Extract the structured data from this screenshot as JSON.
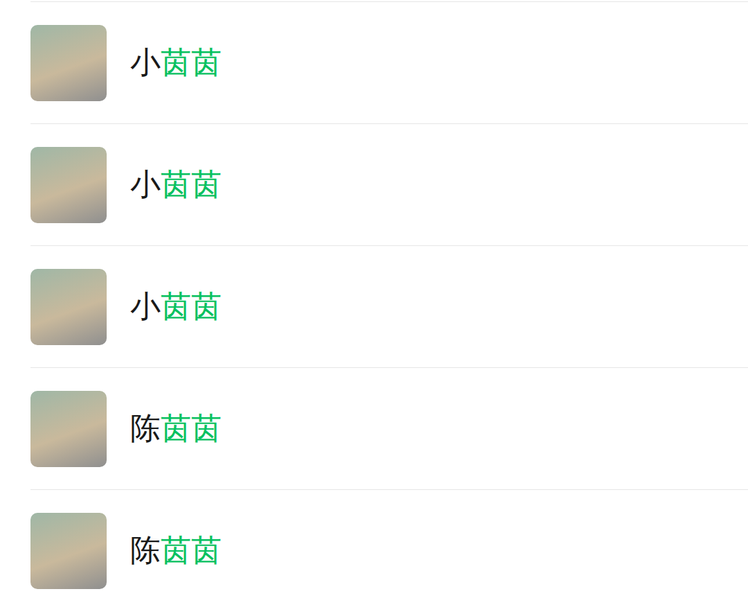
{
  "results": [
    {
      "name": [
        {
          "text": "小",
          "highlighted": false
        },
        {
          "text": "茵茵",
          "highlighted": true
        }
      ]
    },
    {
      "name": [
        {
          "text": "小",
          "highlighted": false
        },
        {
          "text": "茵茵",
          "highlighted": true
        }
      ]
    },
    {
      "name": [
        {
          "text": "小",
          "highlighted": false
        },
        {
          "text": "茵茵",
          "highlighted": true
        }
      ]
    },
    {
      "name": [
        {
          "text": "陈",
          "highlighted": false
        },
        {
          "text": "茵茵",
          "highlighted": true
        }
      ]
    },
    {
      "name": [
        {
          "text": "陈",
          "highlighted": false
        },
        {
          "text": "茵茵",
          "highlighted": true
        }
      ]
    }
  ]
}
